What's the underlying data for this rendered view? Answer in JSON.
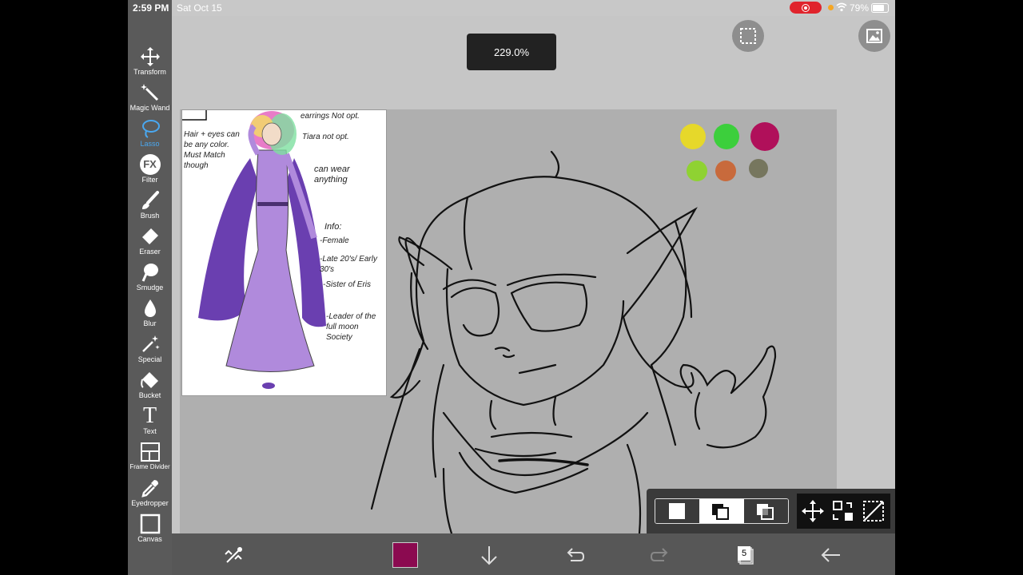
{
  "status": {
    "time": "2:59 PM",
    "date": "Sat Oct 15",
    "battery": "79%"
  },
  "zoom": {
    "label": "229.0%"
  },
  "toolbar": {
    "items": [
      {
        "label": "Transform",
        "icon": "move-arrows-icon"
      },
      {
        "label": "Magic Wand",
        "icon": "magic-wand-icon"
      },
      {
        "label": "Lasso",
        "icon": "lasso-icon",
        "active": true
      },
      {
        "label": "Filter",
        "icon": "fx-icon"
      },
      {
        "label": "Brush",
        "icon": "brush-icon"
      },
      {
        "label": "Eraser",
        "icon": "eraser-icon"
      },
      {
        "label": "Smudge",
        "icon": "smudge-icon"
      },
      {
        "label": "Blur",
        "icon": "blur-drop-icon"
      },
      {
        "label": "Special",
        "icon": "special-wand-icon"
      },
      {
        "label": "Bucket",
        "icon": "bucket-icon"
      },
      {
        "label": "Text",
        "icon": "text-icon"
      },
      {
        "label": "Frame Divider",
        "icon": "frame-divider-icon"
      },
      {
        "label": "Eyedropper",
        "icon": "eyedropper-icon"
      },
      {
        "label": "Canvas",
        "icon": "canvas-icon"
      }
    ],
    "fx_text": "FX",
    "text_glyph": "T"
  },
  "palette": [
    "#e6d82a",
    "#3ccf3c",
    "#b0105a",
    "#8fd232",
    "#c86a3c",
    "#76765e"
  ],
  "current_color": "#8b0a50",
  "layers": {
    "count": "5"
  },
  "reference": {
    "top_note": "earrings Not opt.",
    "tiara_note": "Tiara not opt.",
    "hair_note": "Hair + eyes can be any color. Must Match though",
    "wear_note": "can wear anything",
    "info_title": "Info:",
    "info_lines": [
      "-Female",
      "-Late 20's/ Early 30's",
      "-Sister of Eris",
      "-Leader of the full moon Society"
    ]
  }
}
